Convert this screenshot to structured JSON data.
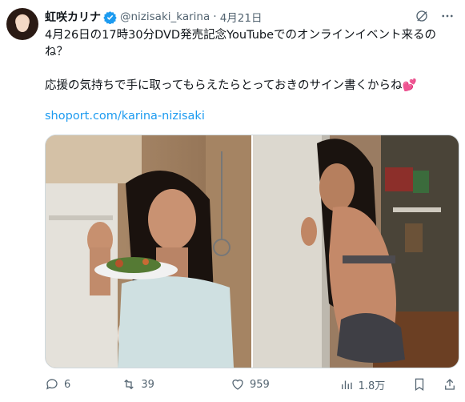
{
  "tweet": {
    "display_name": "虹咲カリナ",
    "handle": "@nizisaki_karina",
    "date": "4月21日",
    "body_line1": "4月26日の17時30分DVD発売記念YouTubeでのオンラインイベント来るの",
    "body_line2": "ね？",
    "body_line3": "応援の気持ちで手に取ってもらえたらとっておきのサイン書くからね",
    "emoji": "💕",
    "link": "shoport.com/karina-nizisaki"
  },
  "actions": {
    "replies": "6",
    "reposts": "39",
    "likes": "959",
    "views": "1.8万"
  },
  "icons": {
    "verified": "verified-badge-icon",
    "grok": "grok-icon",
    "more": "more-icon",
    "reply": "reply-icon",
    "repost": "repost-icon",
    "like": "like-icon",
    "views": "views-icon",
    "bookmark": "bookmark-icon",
    "share": "share-icon"
  },
  "colors": {
    "link": "#1d9bf0",
    "muted": "#536471",
    "verified": "#1d9bf0",
    "heart_emoji": "#e0245e"
  }
}
